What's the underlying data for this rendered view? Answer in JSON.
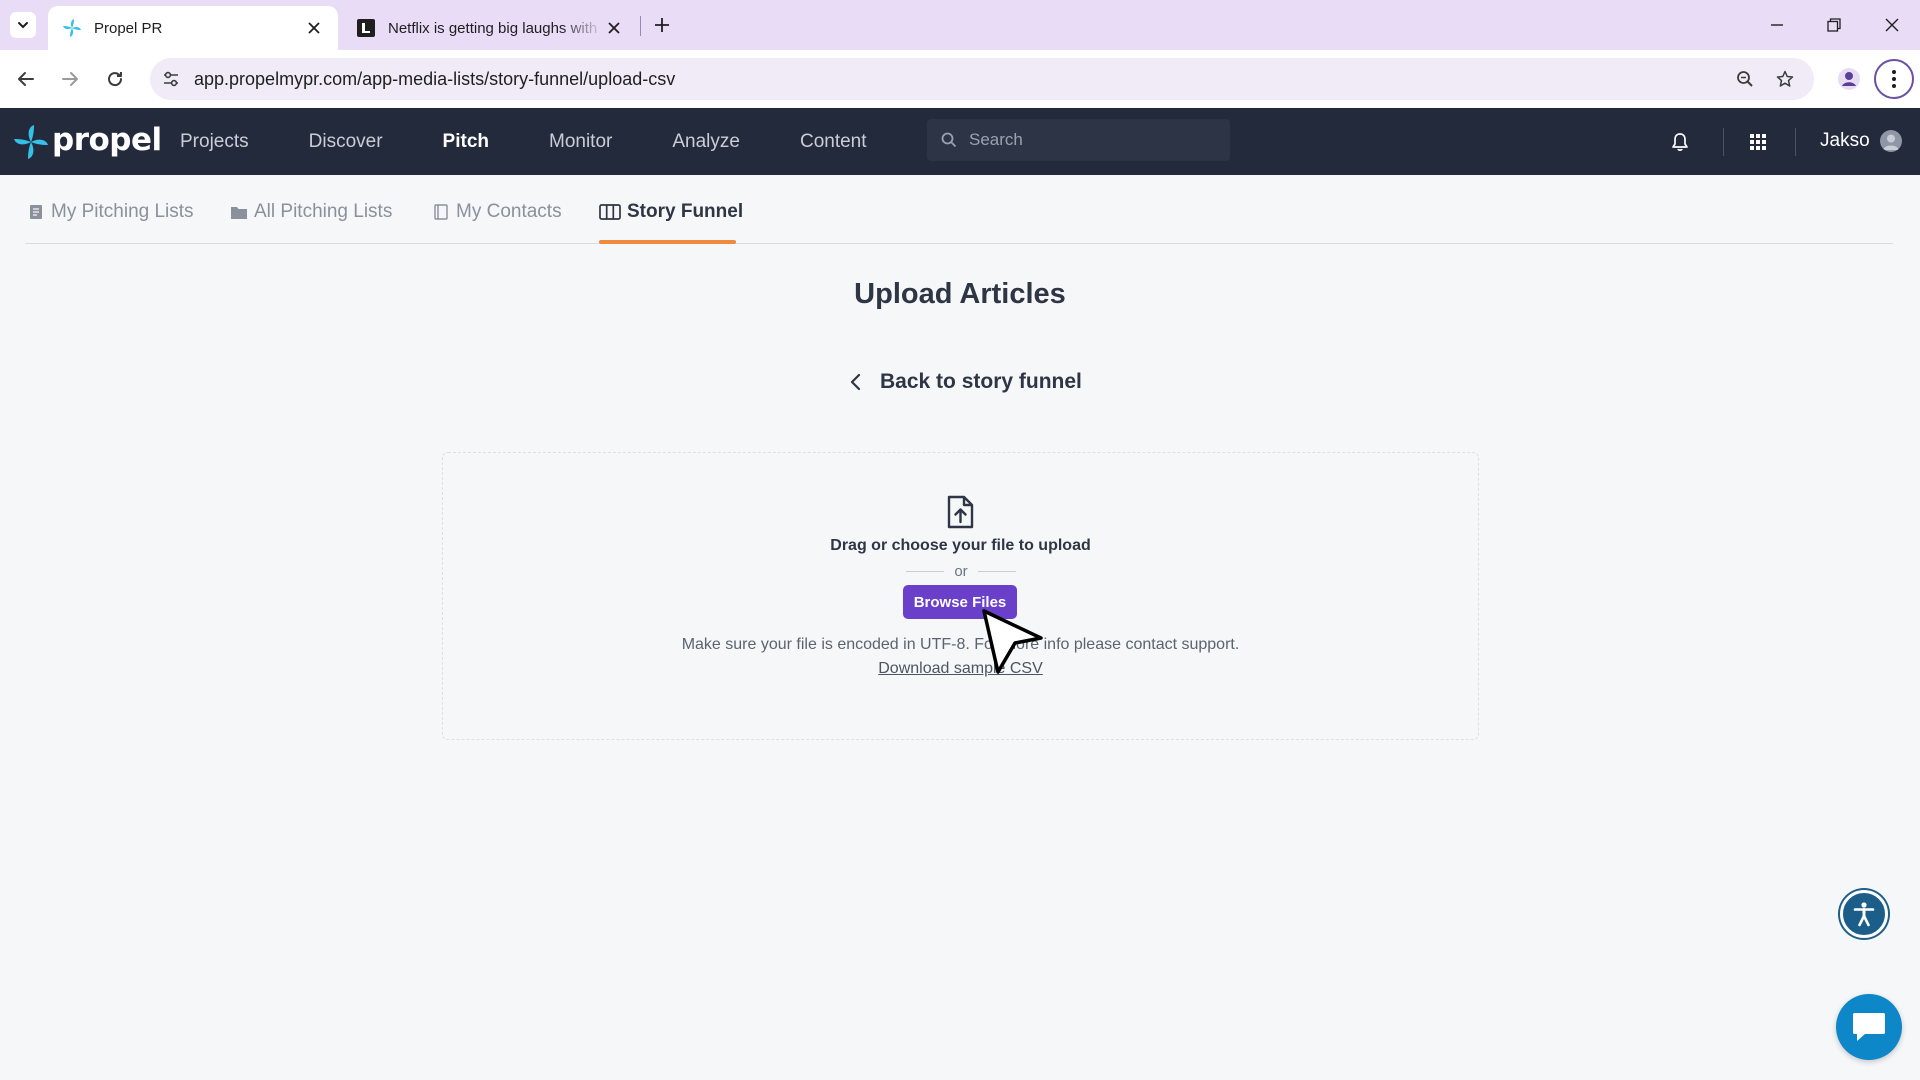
{
  "browser": {
    "tabs": [
      {
        "title": "Propel PR",
        "active": true,
        "icon": "propel-logo-icon"
      },
      {
        "title": "Netflix is getting big laughs with",
        "active": false,
        "icon": "article-site-icon"
      }
    ],
    "url": "app.propelmypr.com/app-media-lists/story-funnel/upload-csv"
  },
  "app": {
    "logo_text": "propel",
    "nav": [
      {
        "label": "Projects",
        "active": false
      },
      {
        "label": "Discover",
        "active": false
      },
      {
        "label": "Pitch",
        "active": true
      },
      {
        "label": "Monitor",
        "active": false
      },
      {
        "label": "Analyze",
        "active": false
      },
      {
        "label": "Content",
        "active": false
      }
    ],
    "search_placeholder": "Search",
    "user_name": "Jakso"
  },
  "subtabs": [
    {
      "label": "My Pitching Lists",
      "icon": "list-icon",
      "active": false
    },
    {
      "label": "All Pitching Lists",
      "icon": "folder-icon",
      "active": false
    },
    {
      "label": "My Contacts",
      "icon": "contacts-book-icon",
      "active": false
    },
    {
      "label": "Story Funnel",
      "icon": "columns-icon",
      "active": true
    }
  ],
  "main": {
    "title": "Upload Articles",
    "back_link": "Back to story funnel",
    "dropzone": {
      "prompt": "Drag or choose your file to upload",
      "or": "or",
      "browse_label": "Browse Files",
      "help_text": "Make sure your file is encoded in UTF-8. For more info please contact support.",
      "sample_link": "Download sample CSV"
    }
  },
  "colors": {
    "appbar": "#232a3b",
    "accent_orange": "#f08a3c",
    "primary_purple": "#6a3fc9",
    "tabbar": "#e9dcf6",
    "chat": "#0e87c9",
    "accessibility": "#1b5e8a"
  }
}
